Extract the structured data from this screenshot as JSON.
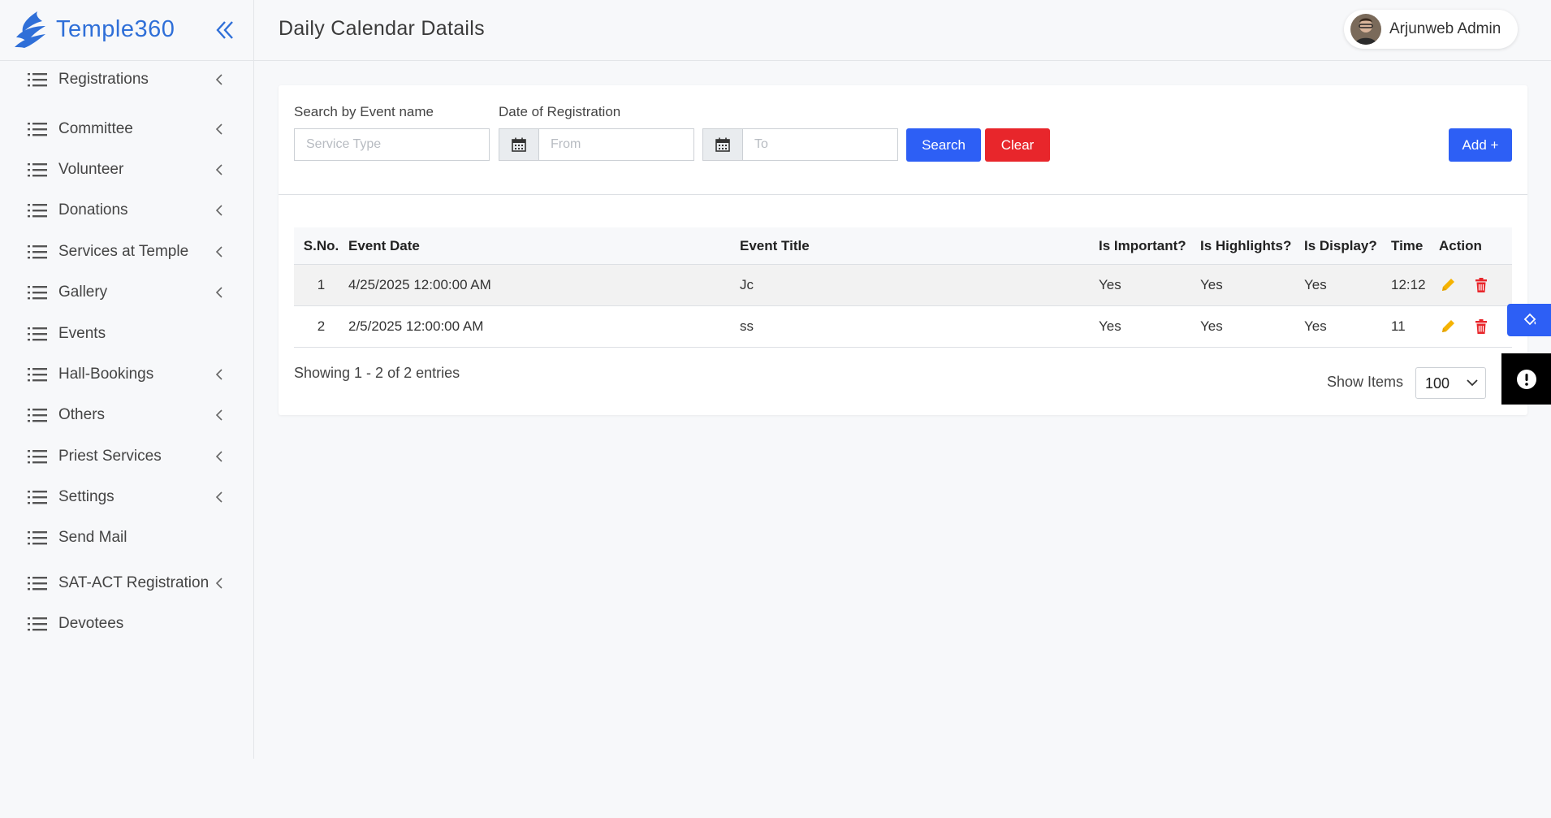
{
  "brand": {
    "name": "Temple360"
  },
  "sidebar": {
    "items": [
      {
        "label": "Registrations",
        "has_children": true
      },
      {
        "label": "Committee",
        "has_children": true
      },
      {
        "label": "Volunteer",
        "has_children": true
      },
      {
        "label": "Donations",
        "has_children": true
      },
      {
        "label": "Services at Temple",
        "has_children": true
      },
      {
        "label": "Gallery",
        "has_children": true
      },
      {
        "label": "Events",
        "has_children": false
      },
      {
        "label": "Hall-Bookings",
        "has_children": true
      },
      {
        "label": "Others",
        "has_children": true
      },
      {
        "label": "Priest Services",
        "has_children": true
      },
      {
        "label": "Settings",
        "has_children": true
      },
      {
        "label": "Send Mail",
        "has_children": false
      },
      {
        "label": "SAT-ACT Registration",
        "has_children": true
      },
      {
        "label": "Devotees",
        "has_children": false
      }
    ]
  },
  "header": {
    "title": "Daily Calendar Datails",
    "user_name": "Arjunweb Admin"
  },
  "filters": {
    "event_name_label": "Search by Event name",
    "event_name_placeholder": "Service Type",
    "date_label": "Date of Registration",
    "from_placeholder": "From",
    "to_placeholder": "To",
    "search_label": "Search",
    "clear_label": "Clear",
    "add_label": "Add +"
  },
  "table": {
    "columns": [
      "S.No.",
      "Event Date",
      "Event Title",
      "Is Important?",
      "Is Highlights?",
      "Is Display?",
      "Time",
      "Action"
    ],
    "rows": [
      {
        "sno": "1",
        "date": "4/25/2025 12:00:00 AM",
        "title": "Jc",
        "important": "Yes",
        "highlights": "Yes",
        "display": "Yes",
        "time": "12:12"
      },
      {
        "sno": "2",
        "date": "2/5/2025 12:00:00 AM",
        "title": "ss",
        "important": "Yes",
        "highlights": "Yes",
        "display": "Yes",
        "time": "11"
      }
    ]
  },
  "pagination": {
    "showing": "Showing 1 - 2 of 2 entries",
    "show_items_label": "Show Items",
    "page_size": "100"
  },
  "colors": {
    "brand": "#2f6fd8",
    "primary": "#2d5ff5",
    "danger": "#e8262b",
    "edit": "#f5b301",
    "delete": "#e8262b"
  }
}
